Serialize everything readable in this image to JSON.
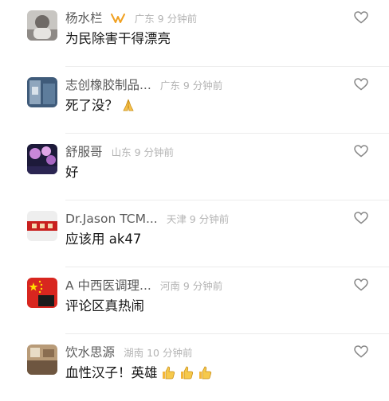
{
  "comments": [
    {
      "user": "杨水栏",
      "meta": "广东 9 分钟前",
      "text": "为民除害干得漂亮",
      "badge_icon": "vip-badge-icon",
      "avatar_icon": "user-avatar-photo"
    },
    {
      "user": "志创橡胶制品...",
      "meta": "广东 9 分钟前",
      "text": "死了没？",
      "text_emoji": "praying-hands-icon",
      "avatar_icon": "machinery-avatar-photo"
    },
    {
      "user": "舒服哥",
      "meta": "山东 9 分钟前",
      "text": "好",
      "avatar_icon": "night-blossom-avatar-photo"
    },
    {
      "user": "Dr.Jason TCM...",
      "meta": "天津 9 分钟前",
      "text": "应该用 ak47",
      "avatar_icon": "red-banner-avatar-photo"
    },
    {
      "user": "A 中西医调理...",
      "meta": "河南 9 分钟前",
      "text": "评论区真热闹",
      "avatar_icon": "china-flag-avatar-photo"
    },
    {
      "user": "饮水思源",
      "meta": "湖南 10 分钟前",
      "text": "血性汉子！英雄",
      "text_emoji": "thumbs-up-icon",
      "avatar_icon": "room-avatar-photo"
    }
  ],
  "icons": {
    "like": "heart-outline-icon"
  },
  "colors": {
    "username": "#5a5a5a",
    "meta": "#b3b3b3",
    "text": "#151515",
    "divider": "#ececec",
    "badge": "#f0a020"
  }
}
